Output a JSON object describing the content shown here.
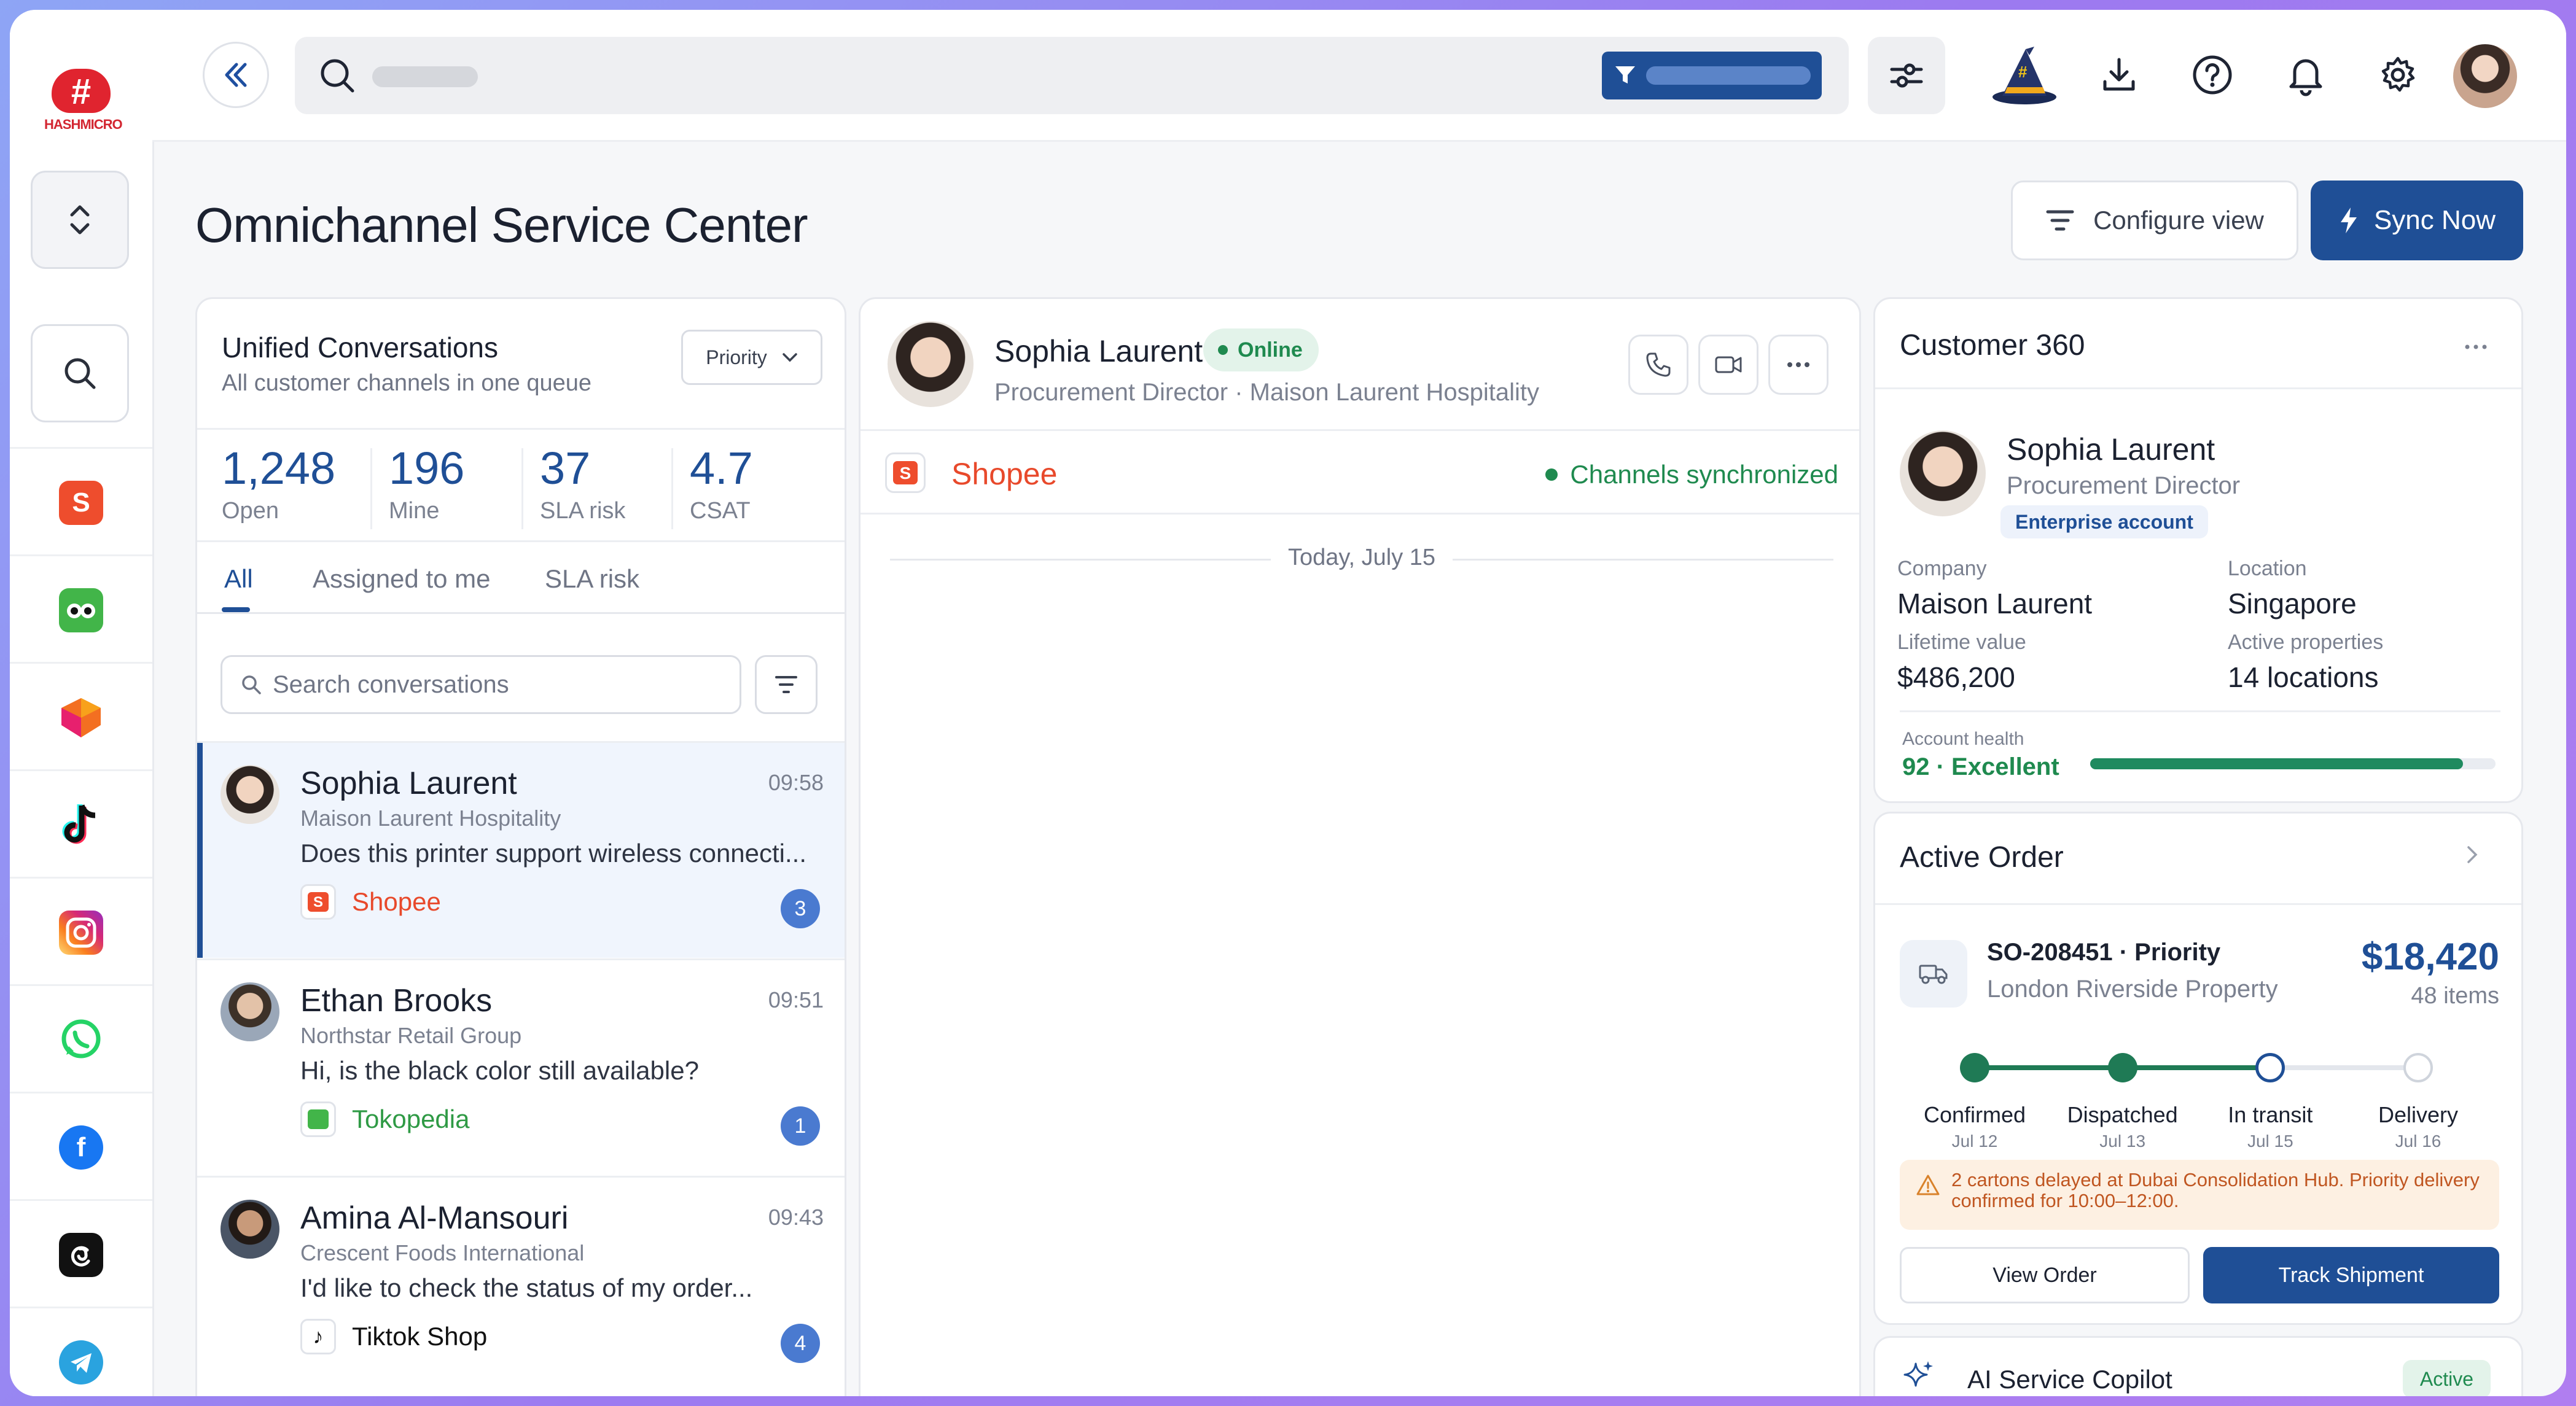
{
  "app": {
    "logo_text": "HASHMICRO",
    "logo_glyph": "#"
  },
  "rail": {
    "apps": [
      {
        "name": "shopee",
        "color": "#ee4d2d"
      },
      {
        "name": "tokopedia",
        "color": "#42b549"
      },
      {
        "name": "lazada",
        "color": "#f36f21"
      },
      {
        "name": "tiktok",
        "color": "#111111"
      },
      {
        "name": "instagram",
        "color": "#d62976"
      },
      {
        "name": "whatsapp",
        "color": "#25d366"
      },
      {
        "name": "facebook",
        "color": "#1877f2"
      },
      {
        "name": "threads",
        "color": "#111111"
      },
      {
        "name": "telegram",
        "color": "#2aa3df"
      }
    ]
  },
  "header": {
    "title": "Omnichannel Service Center",
    "configure_label": "Configure view",
    "sync_label": "Sync Now"
  },
  "conversations": {
    "title": "Unified Conversations",
    "subtitle": "All customer channels in one queue",
    "sort_label": "Priority",
    "stats": [
      {
        "value": "1,248",
        "label": "Open"
      },
      {
        "value": "196",
        "label": "Mine"
      },
      {
        "value": "37",
        "label": "SLA risk"
      },
      {
        "value": "4.7",
        "label": "CSAT"
      }
    ],
    "tabs": [
      "All",
      "Assigned to me",
      "SLA risk"
    ],
    "search_placeholder": "Search conversations",
    "items": [
      {
        "name": "Sophia Laurent",
        "time": "09:58",
        "org": "Maison Laurent Hospitality",
        "message": "Does this printer support wireless connecti...",
        "channel": "Shopee",
        "channel_color": "#e8492b",
        "count": "3"
      },
      {
        "name": "Ethan Brooks",
        "time": "09:51",
        "org": "Northstar Retail Group",
        "message": "Hi, is the black color still available?",
        "channel": "Tokopedia",
        "channel_color": "#2f9a45",
        "count": "1"
      },
      {
        "name": "Amina Al-Mansouri",
        "time": "09:43",
        "org": "Crescent Foods International",
        "message": "I'd like to check the status of my order...",
        "channel": "Tiktok Shop",
        "channel_color": "#111111",
        "count": "4"
      }
    ]
  },
  "chat": {
    "name": "Sophia Laurent",
    "status": "Online",
    "role": "Procurement Director · Maison Laurent Hospitality",
    "channel": "Shopee",
    "sync_status": "Channels synchronized",
    "date_divider": "Today, July 15"
  },
  "customer360": {
    "title": "Customer 360",
    "name": "Sophia Laurent",
    "role": "Procurement Director",
    "tier": "Enterprise account",
    "fields": [
      {
        "label": "Company",
        "value": "Maison Laurent"
      },
      {
        "label": "Location",
        "value": "Singapore"
      },
      {
        "label": "Lifetime value",
        "value": "$486,200"
      },
      {
        "label": "Active properties",
        "value": "14 locations"
      }
    ],
    "health_label": "Account health",
    "health_value": "92 · Excellent",
    "health_fraction": 0.92
  },
  "order": {
    "title": "Active Order",
    "id": "SO-208451 · Priority",
    "location": "London Riverside Property",
    "amount": "$18,420",
    "items": "48 items",
    "steps": [
      {
        "label": "Confirmed",
        "date": "Jul 12",
        "state": "done"
      },
      {
        "label": "Dispatched",
        "date": "Jul 13",
        "state": "done"
      },
      {
        "label": "In transit",
        "date": "Jul 15",
        "state": "current"
      },
      {
        "label": "Delivery",
        "date": "Jul 16",
        "state": "pending"
      }
    ],
    "warning": "2 cartons delayed at Dubai Consolidation Hub. Priority delivery confirmed for 10:00–12:00.",
    "view_label": "View Order",
    "track_label": "Track Shipment"
  },
  "ai": {
    "title": "AI Service Copilot",
    "status": "Active"
  },
  "colors": {
    "accent": "#1f4f96",
    "success": "#1f8a4f",
    "shopee": "#ee4d2d"
  }
}
